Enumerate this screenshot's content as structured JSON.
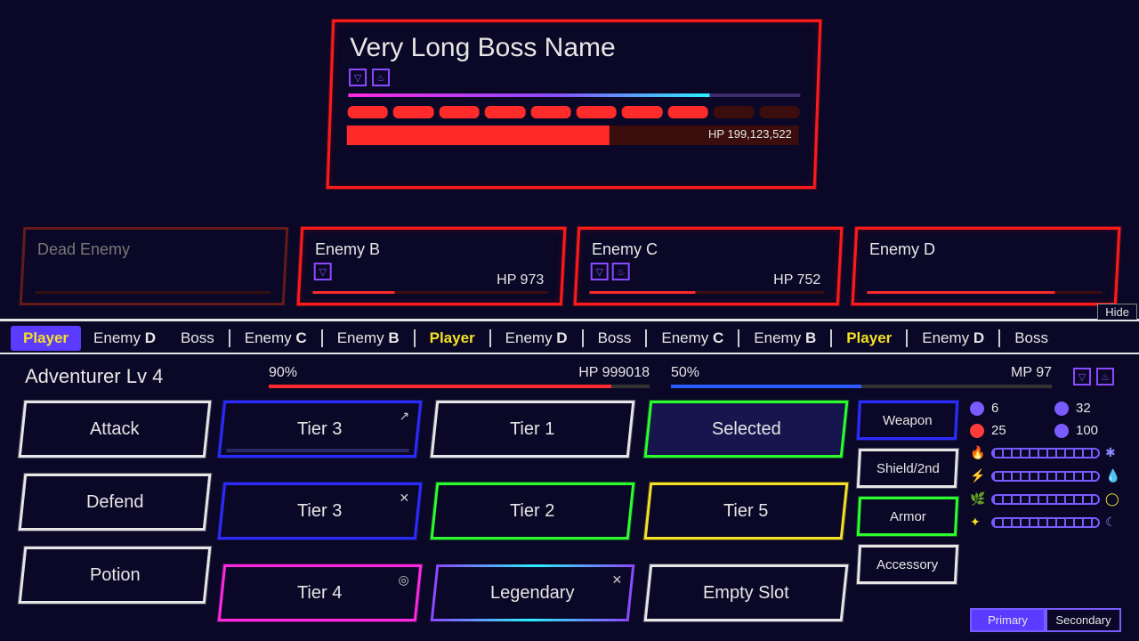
{
  "boss": {
    "name": "Very Long Boss Name",
    "status_icons": [
      "shield-up-icon",
      "flame-up-icon"
    ],
    "timer_pct": 80,
    "segments": {
      "filled": 8,
      "total": 10
    },
    "hp_pct": 58,
    "hp_label": "HP 199,123,522"
  },
  "enemies": [
    {
      "name": "Dead Enemy",
      "dead": true
    },
    {
      "name": "Enemy B",
      "hp_label": "HP 973",
      "hp_pct": 35,
      "icons": [
        "shield-up-icon"
      ]
    },
    {
      "name": "Enemy C",
      "hp_label": "HP 752",
      "hp_pct": 45,
      "icons": [
        "shield-up-icon",
        "flame-up-icon"
      ]
    },
    {
      "name": "Enemy D",
      "hp_pct": 80
    }
  ],
  "hide_label": "Hide",
  "turn_order": [
    {
      "label": "Player",
      "kind": "current"
    },
    {
      "label": "Enemy ",
      "bold": "D"
    },
    {
      "label": "Boss"
    },
    {
      "sep": true
    },
    {
      "label": "Enemy ",
      "bold": "C"
    },
    {
      "sep_thin": true
    },
    {
      "label": "Enemy ",
      "bold": "B"
    },
    {
      "sep_thin": true
    },
    {
      "label": "Player",
      "kind": "player"
    },
    {
      "sep_thin": true
    },
    {
      "label": "Enemy ",
      "bold": "D"
    },
    {
      "sep_thin": true
    },
    {
      "label": "Boss"
    },
    {
      "sep": true
    },
    {
      "label": "Enemy ",
      "bold": "C"
    },
    {
      "sep_thin": true
    },
    {
      "label": "Enemy ",
      "bold": "B"
    },
    {
      "sep_thin": true
    },
    {
      "label": "Player",
      "kind": "player"
    },
    {
      "sep_thin": true
    },
    {
      "label": "Enemy ",
      "bold": "D"
    },
    {
      "sep_thin": true
    },
    {
      "label": "Boss"
    }
  ],
  "player": {
    "name": "Adventurer Lv 4",
    "hp_pct_label": "90%",
    "hp_pct": 90,
    "hp_label": "HP 999018",
    "mp_pct_label": "50%",
    "mp_pct": 50,
    "mp_label": "MP 97",
    "status_icons": [
      "shield-up-icon",
      "flame-up-icon"
    ]
  },
  "commands": [
    {
      "label": "Attack"
    },
    {
      "label": "Defend"
    },
    {
      "label": "Potion"
    }
  ],
  "skills": [
    {
      "label": "Tier 3",
      "tier": "blue",
      "icon": "↗",
      "cooldown": true
    },
    {
      "label": "Tier 1",
      "tier": "white"
    },
    {
      "label": "Selected",
      "tier": "green",
      "selected": true
    },
    {
      "label": "Tier 3",
      "tier": "blue",
      "icon": "✕"
    },
    {
      "label": "Tier 2",
      "tier": "green"
    },
    {
      "label": "Tier 5",
      "tier": "yellow"
    },
    {
      "label": "Tier 4",
      "tier": "magenta",
      "icon": "◎"
    },
    {
      "label": "Legendary",
      "tier": "gradient",
      "icon": "✕"
    },
    {
      "label": "Empty Slot",
      "tier": "white"
    }
  ],
  "equip_slots": [
    {
      "label": "Weapon",
      "tier": "blue"
    },
    {
      "label": "Shield/2nd",
      "tier": "white"
    },
    {
      "label": "Armor",
      "tier": "green"
    },
    {
      "label": "Accessory",
      "tier": "white"
    }
  ],
  "stats": {
    "rows": [
      [
        {
          "icon": "swirl",
          "color": "#7a5bff",
          "value": "6"
        },
        {
          "icon": "shield",
          "color": "#7a5bff",
          "value": "32"
        }
      ],
      [
        {
          "icon": "wing",
          "color": "#ff3b3b",
          "value": "25"
        },
        {
          "icon": "bow",
          "color": "#7a5bff",
          "value": "100"
        }
      ]
    ],
    "elements": [
      {
        "icon": "🔥",
        "color": "#ff3b3b",
        "end": "✱",
        "end_color": "#8a8aff"
      },
      {
        "icon": "⚡",
        "color": "#b04bff",
        "end": "💧",
        "end_color": "#5ab0ff"
      },
      {
        "icon": "🌿",
        "color": "#3bd83b",
        "end": "◯",
        "end_color": "#f4e024"
      },
      {
        "icon": "✦",
        "color": "#f4e024",
        "end": "☾",
        "end_color": "#8a8aff"
      }
    ],
    "tabs": {
      "primary": "Primary",
      "secondary": "Secondary",
      "active": "primary"
    }
  }
}
